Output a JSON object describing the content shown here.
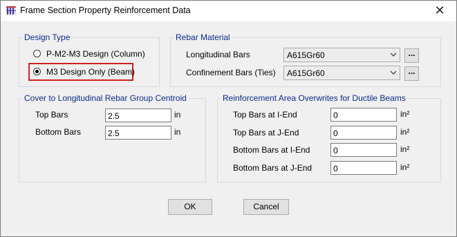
{
  "window": {
    "title": "Frame Section Property Reinforcement Data",
    "close_symbol": "✕",
    "icon": "app-grid-icon"
  },
  "design_type": {
    "legend": "Design Type",
    "options": [
      {
        "label": "P-M2-M3 Design  (Column)",
        "checked": false
      },
      {
        "label": "M3 Design Only  (Beam)",
        "checked": true
      }
    ],
    "highlight_color": "#d31f1f"
  },
  "rebar_material": {
    "legend": "Rebar Material",
    "longitudinal_label": "Longitudinal Bars",
    "longitudinal_value": "A615Gr60",
    "confinement_label": "Confinement Bars (Ties)",
    "confinement_value": "A615Gr60",
    "more_button_label": "..."
  },
  "cover": {
    "legend": "Cover to Longitudinal Rebar Group Centroid",
    "top_label": "Top Bars",
    "top_value": "2.5",
    "bottom_label": "Bottom  Bars",
    "bottom_value": "2.5",
    "unit": "in"
  },
  "overwrites": {
    "legend": "Reinforcement Area Overwrites for Ductile Beams",
    "unit": "in²",
    "rows": [
      {
        "label": "Top Bars at I-End",
        "value": "0"
      },
      {
        "label": "Top Bars at J-End",
        "value": "0"
      },
      {
        "label": "Bottom Bars at I-End",
        "value": "0"
      },
      {
        "label": "Bottom Bars at J-End",
        "value": "0"
      }
    ]
  },
  "buttons": {
    "ok": "OK",
    "cancel": "Cancel"
  },
  "colors": {
    "legend_text": "#0b2a8c",
    "dialog_bg": "#f0f0f0"
  }
}
